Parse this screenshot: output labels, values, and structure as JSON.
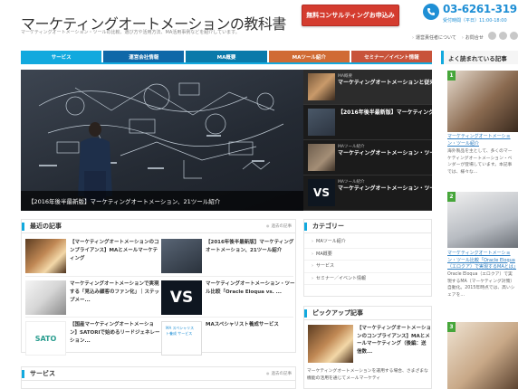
{
  "header": {
    "title": "マーケティングオートメーションの教科書",
    "description": "マーケティングオートメーション・ツールの比較、選び方や活用方法、MA活用事例などを紹介しています。",
    "cta_label": "無料コンサルティングお申込み",
    "phone_number": "03-6261-3191",
    "phone_hours": "受付時間（平日）11:00-18:00",
    "util_links": [
      "運営責任者について",
      "お問合せ"
    ]
  },
  "nav": {
    "tabs": [
      {
        "label": "サービス",
        "color": "#12a9de"
      },
      {
        "label": "運営会社情報",
        "color": "#0f68a8"
      },
      {
        "label": "MA概要",
        "color": "#0a7aaa"
      },
      {
        "label": "MAツール紹介",
        "color": "#d06b34"
      },
      {
        "label": "セミナー／イベント情報",
        "color": "#c8533a"
      }
    ]
  },
  "hero": {
    "caption": "【2016年後半最新版】マーケティングオートメーション、21ツール紹介"
  },
  "slider": {
    "items": [
      {
        "category": "MA概要",
        "title": "マーケティングオートメーションと従来ステップメールの違い..."
      },
      {
        "category": "",
        "title": "【2016年後半最新版】マーケティングオートメーション、..."
      },
      {
        "category": "MAツール紹介",
        "title": "マーケティングオートメーション・ツール紹介"
      },
      {
        "category": "MAツール紹介",
        "title": "マーケティングオートメーション・ツール比較「フロムスクラ..."
      }
    ]
  },
  "recent": {
    "title": "最近の記事",
    "more_label": "過去の記事",
    "articles": [
      {
        "title": "【マーケティングオートメーションのコンプライアンス】MAとメールマーケティング"
      },
      {
        "title": "【2016年後半最新版】マーケティングオートメーション、21ツール紹介"
      },
      {
        "title": "マーケティングオートメーションで実現する「見込み顧客のファン化」｜ステップメー..."
      },
      {
        "title": "マーケティングオートメーション・ツール比較「Oracle Eloqua vs. ..."
      },
      {
        "title": "【国産マーケティングオートメーション】SATORIで始めるリードジェネレーション..."
      },
      {
        "title": "MAスペシャリスト養成サービス"
      }
    ],
    "thumb_vs_label": "VS",
    "thumb_sato_label": "SATO",
    "thumb_service_label": "MA スペシャリスト養成 サービス"
  },
  "services": {
    "title": "サービス",
    "more_label": "過去の記事"
  },
  "category": {
    "title": "カテゴリー",
    "items": [
      "MAツール紹介",
      "MA概要",
      "サービス",
      "セミナー／イベント情報"
    ]
  },
  "pickup": {
    "title": "ピックアップ記事",
    "article_title": "【マーケティングオートメーションのコンプライアンス】MAとメールマーケティング（後編：送信数...",
    "description": "マーケティングオートメーションを運用する場合、さまざまな機能の活用を通じてメールマーケティ"
  },
  "sidebar": {
    "title": "よく読まれている記事",
    "ranks": [
      {
        "num": "1",
        "title": "マーケティングオートメーション・ツール紹介",
        "desc": "海外製品を主として、多くのマーケティングオートメーション・ベンダーが登場しています。本記事では、様々な..."
      },
      {
        "num": "2",
        "title": "マーケティングオートメーション・ツール比較「Oracle Eloqua（エロクア）で実現するMAとは」",
        "desc": "Oracle Eloqua（エロクア）で実現するMA（マーケティング対策）自動化。2015年時点では、高いシェアを..."
      },
      {
        "num": "3",
        "title": "",
        "desc": ""
      }
    ]
  },
  "colors": {
    "accent": "#12a9de",
    "cta": "#d43c2f",
    "phone": "#1f8fd5",
    "rank": "#46a63a"
  }
}
